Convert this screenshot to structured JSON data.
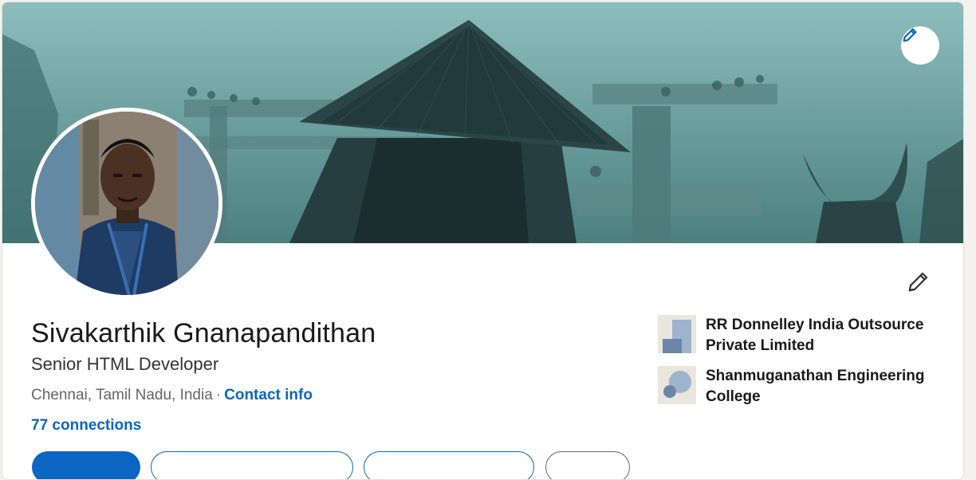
{
  "profile": {
    "name": "Sivakarthik Gnanapandithan",
    "headline": "Senior HTML Developer",
    "location": "Chennai, Tamil Nadu, India",
    "separator": "·",
    "contact_info_label": "Contact info",
    "connections_label": "77 connections"
  },
  "side": {
    "experience": "RR Donnelley India Outsource Private Limited",
    "education": "Shanmuganathan Engineering College"
  },
  "icons": {
    "cover_edit": "pencil-icon",
    "intro_edit": "pencil-icon"
  },
  "colors": {
    "accent": "#0a66c2",
    "cover_tint": "#5e9796",
    "text": "#191919",
    "muted": "#666666"
  }
}
